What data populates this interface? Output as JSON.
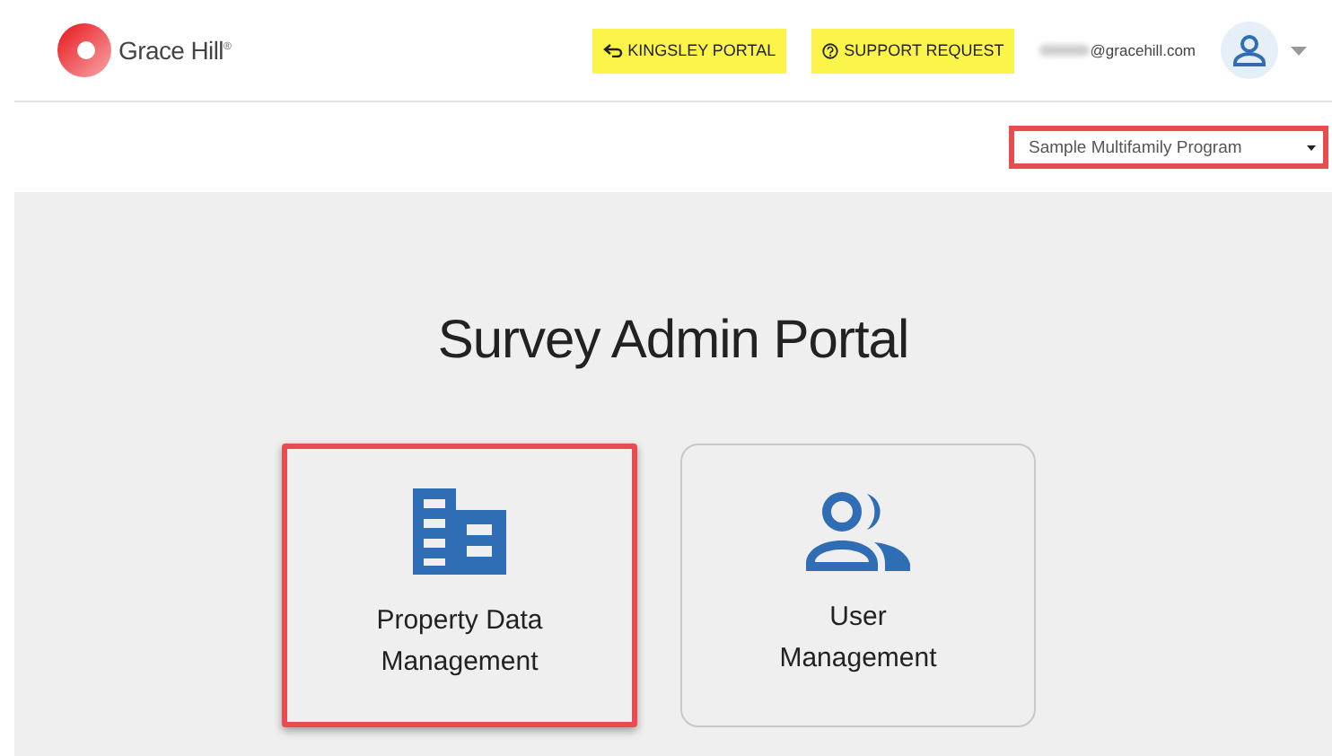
{
  "header": {
    "logo_text": "Grace Hill",
    "logo_mark": "®",
    "buttons": [
      {
        "kind": "back",
        "label": "KINGSLEY PORTAL"
      },
      {
        "kind": "help",
        "label": "SUPPORT REQUEST"
      }
    ],
    "user_email": "@gracehill.com"
  },
  "program_select": {
    "value": "Sample Multifamily Program",
    "highlighted": true
  },
  "title": "Survey Admin Portal",
  "cards": [
    {
      "kind": "building",
      "lines": [
        "Property Data",
        "Management"
      ],
      "highlighted": true
    },
    {
      "kind": "users",
      "lines": [
        "User",
        "Management"
      ],
      "highlighted": false
    }
  ]
}
